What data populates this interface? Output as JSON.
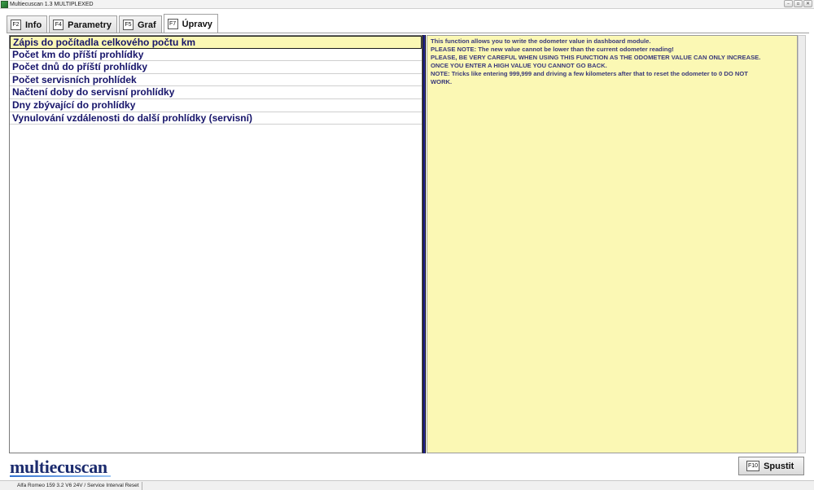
{
  "window": {
    "title": "Multiecuscan 1.3 MULTIPLEXED",
    "minimize_icon": "minimize-icon",
    "restore_icon": "restore-icon",
    "close_icon": "close-icon"
  },
  "tabs": [
    {
      "key": "F2",
      "label": "Info"
    },
    {
      "key": "F4",
      "label": "Parametry"
    },
    {
      "key": "F5",
      "label": "Graf"
    },
    {
      "key": "F7",
      "label": "Úpravy"
    }
  ],
  "active_tab": "Úpravy",
  "functions": [
    "Zápis do počítadla celkového počtu km",
    "Počet km do příští prohlídky",
    "Počet dnů do příští prohlídky",
    "Počet servisních prohlídek",
    "Načtení doby do servisní prohlídky",
    "Dny zbývající do prohlídky",
    "Vynulování vzdálenosti do další prohlídky (servisní)"
  ],
  "selected_function": "Zápis do počítadla celkového počtu km",
  "info_text": [
    "This function allows you to write the odometer value in dashboard module.",
    "PLEASE NOTE: The new value cannot be lower than the current odometer reading!",
    "PLEASE, BE VERY CAREFUL WHEN USING THIS FUNCTION AS THE ODOMETER VALUE CAN ONLY INCREASE.",
    "ONCE YOU ENTER A HIGH VALUE YOU CANNOT GO BACK.",
    "NOTE: Tricks like entering 999,999 and driving a few kilometers after that to reset the odometer to 0 DO NOT",
    "WORK."
  ],
  "logo_text": "multiecuscan",
  "run_button": {
    "key": "F10",
    "label": "Spustit"
  },
  "status": {
    "vehicle": "Alfa Romeo 159 3.2 V6 24V / Service Interval Reset"
  },
  "colors": {
    "info_background": "#fbf8b4",
    "list_text": "#16146a",
    "splitter": "#2b2b9a"
  }
}
